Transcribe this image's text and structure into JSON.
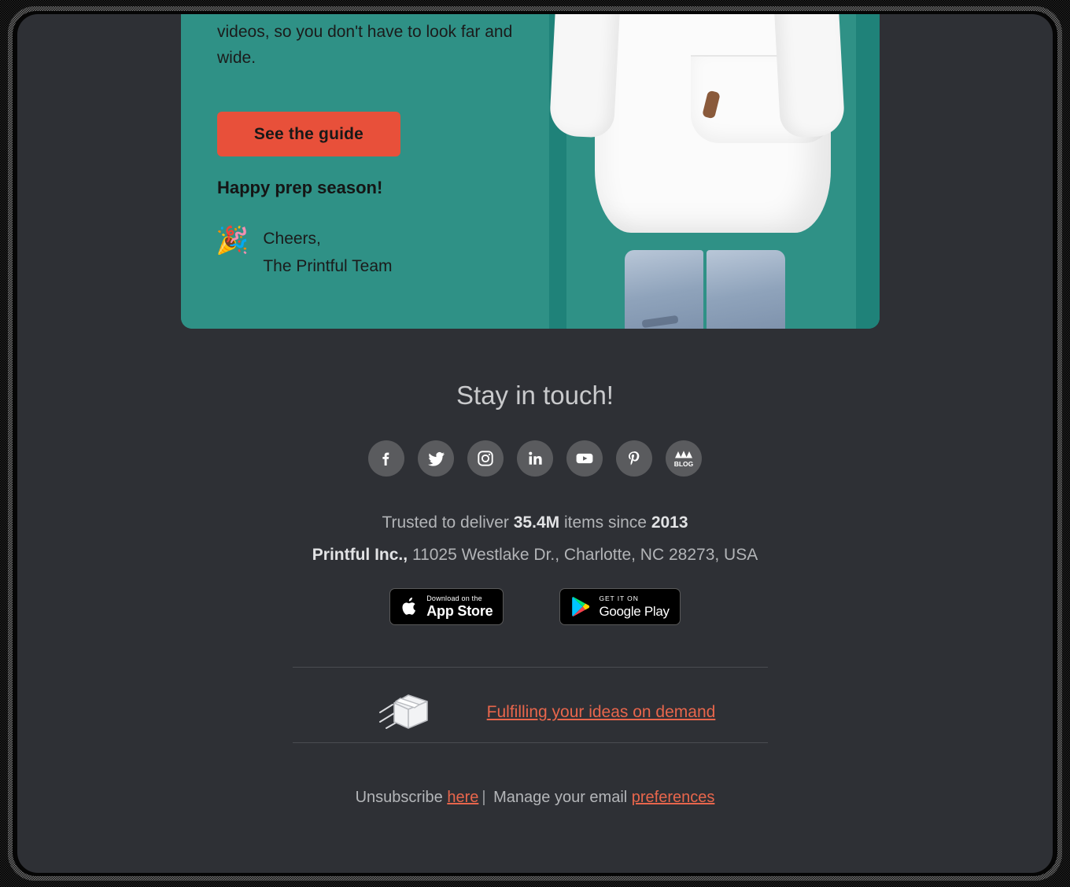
{
  "theme": {
    "page_bg": "#2e3035",
    "teal": "#2f9186",
    "teal_dark": "#1f8279",
    "accent_orange": "#e8503a",
    "link_orange": "#e8664c",
    "text_light": "#b2b4b7",
    "text_bright": "#e2e3e5",
    "divider": "#4a4c51"
  },
  "hero": {
    "body_text": "videos, so you don't have to look far and wide.",
    "cta_label": "See the guide",
    "signoff": "Happy prep season!",
    "popper_icon": "party-popper-icon",
    "cheers_line1": "Cheers,",
    "cheers_line2": "The Printful Team",
    "photo_alt": "person wearing white hoodie with red squiggle print"
  },
  "footer": {
    "stay_title": "Stay in touch!",
    "social": [
      {
        "name": "facebook",
        "label": "Facebook"
      },
      {
        "name": "twitter",
        "label": "Twitter"
      },
      {
        "name": "instagram",
        "label": "Instagram"
      },
      {
        "name": "linkedin",
        "label": "LinkedIn"
      },
      {
        "name": "youtube",
        "label": "YouTube"
      },
      {
        "name": "pinterest",
        "label": "Pinterest"
      },
      {
        "name": "blog",
        "label": "BLOG"
      }
    ],
    "trusted_prefix": "Trusted to deliver ",
    "trusted_count": "35.4M",
    "trusted_mid": " items since ",
    "trusted_year": "2013",
    "company": "Printful Inc.,",
    "address": " 11025 Westlake Dr., Charlotte, NC 28273, USA",
    "app_store": {
      "small": "Download on the",
      "big": "App Store"
    },
    "google_play": {
      "small": "GET IT ON",
      "big": "Google Play"
    },
    "tagline_icon": "shipping-box-icon",
    "tagline_link": "Fulfilling your ideas on demand",
    "unsub_prefix": "Unsubscribe ",
    "unsub_link": "here",
    "unsub_sep": "|",
    "unsub_mid": " Manage your email ",
    "unsub_link2": "preferences"
  }
}
